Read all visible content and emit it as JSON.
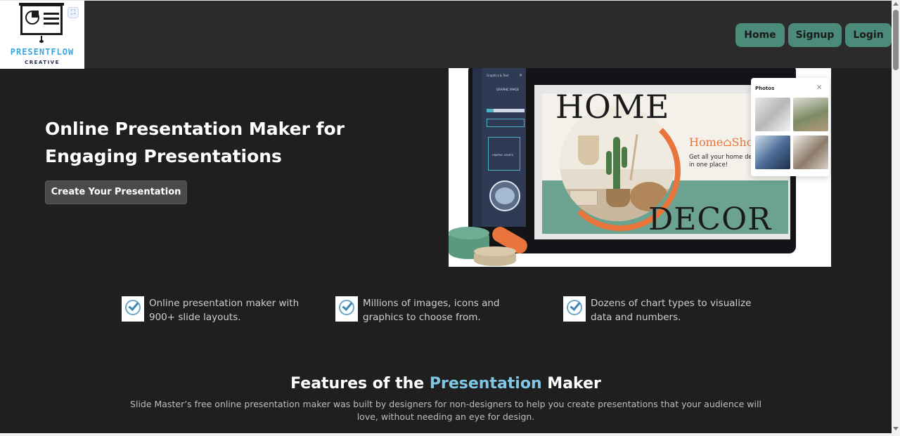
{
  "logo": {
    "name": "PRESENTFLOW",
    "tagline": "CREATIVE",
    "icon": "presentation-board-icon",
    "scan_icon": "scan-icon"
  },
  "nav": {
    "home": "Home",
    "signup": "Signup",
    "login": "Login"
  },
  "hero": {
    "title": "Online Presentation Maker for Engaging Presentations",
    "cta": "Create Your Presentation",
    "image": {
      "editor_panel_title": "Graphics & Text",
      "editor_section": "GRAPHIC IMAGE",
      "editor_assets": "GRAPHIC ASSETS",
      "slide_word_1": "HOME",
      "slide_word_2": "DECOR",
      "slide_brand": "Home⌂Sho",
      "slide_tagline": "Get all your home dec in one place!",
      "photos_title": "Photos",
      "photos_close": "×"
    }
  },
  "bullets": [
    {
      "icon": "check-icon",
      "text": "Online presentation maker with 900+ slide layouts."
    },
    {
      "icon": "check-icon",
      "text": "Millions of images, icons and graphics to choose from."
    },
    {
      "icon": "check-icon",
      "text": "Dozens of chart types to visualize data and numbers."
    }
  ],
  "features": {
    "title_pre": "Features of the ",
    "title_accent": "Presentation",
    "title_post": " Maker",
    "description": "Slide Master’s free online presentation maker was built by designers for non-designers to help you create presentations that your audience will love, without needing an eye for design."
  },
  "colors": {
    "background": "#1f1f1f",
    "header": "#2b2b2b",
    "nav_button": "#4c8a7a",
    "accent": "#7ec8e6",
    "logo_text": "#3aa5dd"
  }
}
